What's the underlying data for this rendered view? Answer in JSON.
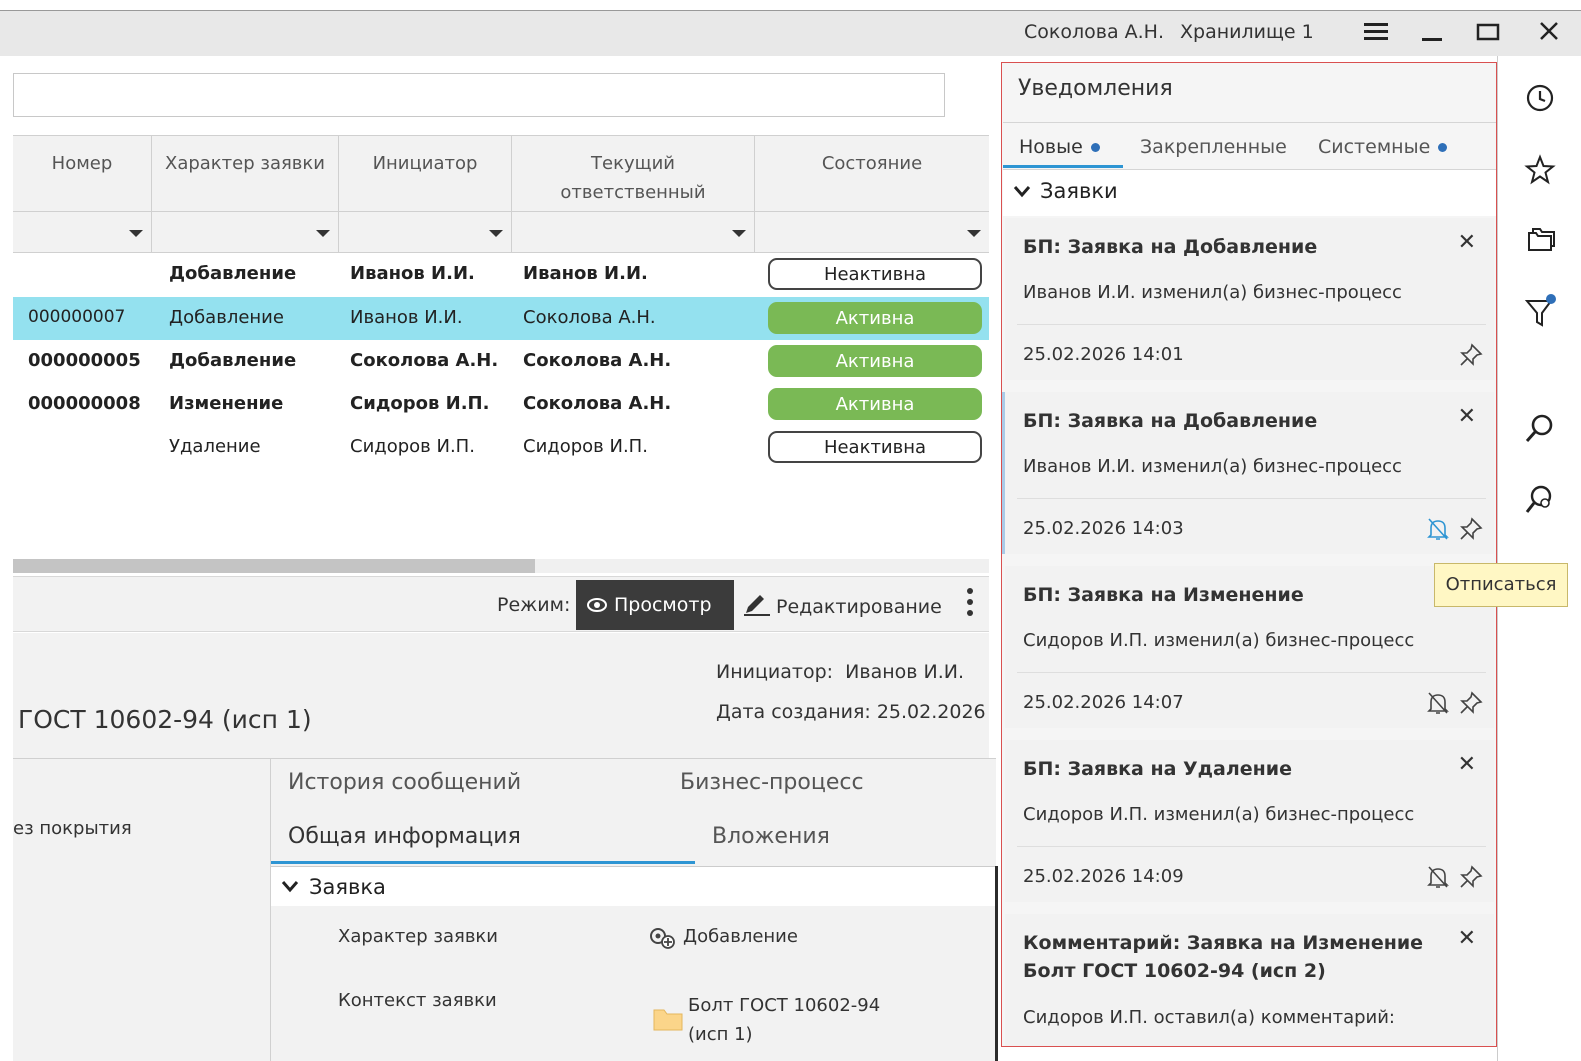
{
  "topbar": {
    "user": "Соколова А.Н.",
    "storage": "Хранилище 1"
  },
  "search": {
    "value": "",
    "placeholder": ""
  },
  "grid": {
    "columns": [
      "Номер",
      "Характер заявки",
      "Инициатор",
      "Текущий ответственный",
      "Состояние"
    ],
    "rows": [
      {
        "number": "",
        "type": "Добавление",
        "initiator": "Иванов И.И.",
        "responsible": "Иванов И.И.",
        "state": "Неактивна",
        "bold": true,
        "selected": false,
        "active": false
      },
      {
        "number": "000000007",
        "type": "Добавление",
        "initiator": "Иванов И.И.",
        "responsible": "Соколова А.Н.",
        "state": "Активна",
        "bold": false,
        "selected": true,
        "active": true
      },
      {
        "number": "000000005",
        "type": "Добавление",
        "initiator": "Соколова А.Н.",
        "responsible": "Соколова А.Н.",
        "state": "Активна",
        "bold": true,
        "selected": false,
        "active": true
      },
      {
        "number": "000000008",
        "type": "Изменение",
        "initiator": "Сидоров И.П.",
        "responsible": "Соколова А.Н.",
        "state": "Активна",
        "bold": true,
        "selected": false,
        "active": true
      },
      {
        "number": "",
        "type": "Удаление",
        "initiator": "Сидоров И.П.",
        "responsible": "Сидоров И.П.",
        "state": "Неактивна",
        "bold": false,
        "selected": false,
        "active": false
      }
    ]
  },
  "toolbar": {
    "mode_label": "Режим:",
    "view_label": "Просмотр",
    "edit_label": "Редактирование"
  },
  "details": {
    "initiator_label": "Инициатор:",
    "initiator_value": "Иванов И.И.",
    "created_label": "Дата создания:",
    "created_value": "25.02.2026",
    "doc_title": "ГОСТ 10602-94 (исп 1)",
    "left_text": "ез покрытия"
  },
  "tabs": {
    "history": "История сообщений",
    "bp": "Бизнес-процесс",
    "general": "Общая информация",
    "attachments": "Вложения"
  },
  "section": {
    "title": "Заявка",
    "type_label": "Характер заявки",
    "type_value": "Добавление",
    "context_label": "Контекст заявки",
    "context_value_1": "Болт ГОСТ 10602-94",
    "context_value_2": "(исп 1)"
  },
  "notifications": {
    "title": "Уведомления",
    "tabs": [
      "Новые",
      "Закрепленные",
      "Системные"
    ],
    "group": "Заявки",
    "cards": [
      {
        "title": "БП: Заявка на Добавление",
        "text": "Иванов И.И. изменил(а) бизнес-процесс",
        "date": "25.02.2026 14:01"
      },
      {
        "title": "БП: Заявка на Добавление",
        "text": "Иванов И.И. изменил(а) бизнес-процесс",
        "date": "25.02.2026 14:03"
      },
      {
        "title": "БП: Заявка на Изменение",
        "text": "Сидоров И.П. изменил(а) бизнес-процесс",
        "date": "25.02.2026 14:07"
      },
      {
        "title": "БП: Заявка на Удаление",
        "text": "Сидоров И.П. изменил(а) бизнес-процесс",
        "date": "25.02.2026 14:09"
      },
      {
        "title": "Комментарий: Заявка на Изменение",
        "title2": "Болт ГОСТ 10602-94 (исп 2)",
        "text": "Сидоров И.П. оставил(а) комментарий:"
      }
    ],
    "tooltip": "Отписаться"
  },
  "colors": {
    "active_badge": "#7ab955",
    "selected_row": "#94e1ef",
    "accent": "#2e95d3"
  }
}
